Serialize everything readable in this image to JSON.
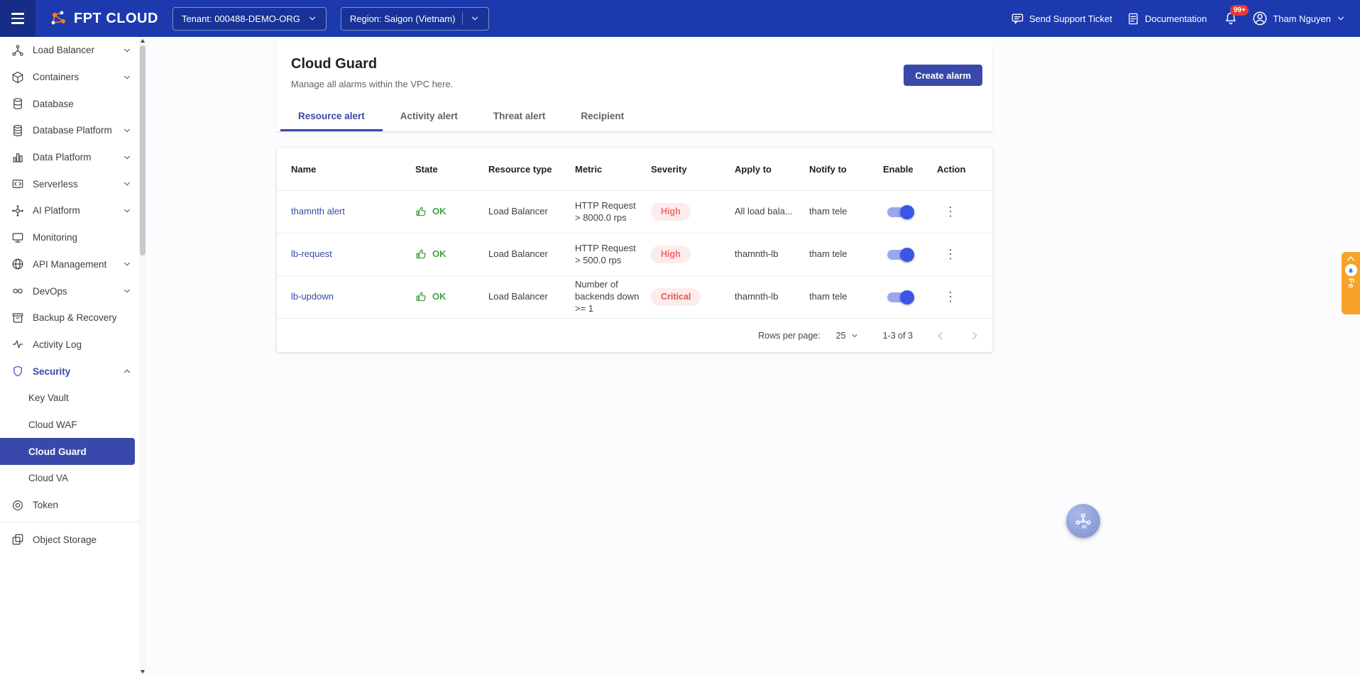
{
  "colors": {
    "topbar": "#1c3aae",
    "accent": "#3949ab",
    "accent_bright": "#3b55e6",
    "toggle_track": "#9aa7ef",
    "success": "#43a047",
    "severity_bg": "#fdecec",
    "severity_high": "#ef6b6b",
    "severity_critical": "#e25555",
    "badge_red": "#e53935",
    "feedback_orange": "#f7a32b"
  },
  "topbar": {
    "logo_text": "FPT CLOUD",
    "tenant": {
      "label": "Tenant: 000488-DEMO-ORG"
    },
    "region": {
      "label": "Region: Saigon (Vietnam)"
    },
    "support_label": "Send Support Ticket",
    "documentation_label": "Documentation",
    "notification_badge": "99+",
    "user_name": "Tham Nguyen"
  },
  "sidebar": {
    "items": [
      {
        "label": "Load Balancer",
        "icon": "load-balancer-icon"
      },
      {
        "label": "Containers",
        "icon": "containers-icon"
      },
      {
        "label": "Database",
        "icon": "database-icon"
      },
      {
        "label": "Database Platform",
        "icon": "database-platform-icon"
      },
      {
        "label": "Data Platform",
        "icon": "data-platform-icon"
      },
      {
        "label": "Serverless",
        "icon": "serverless-icon"
      },
      {
        "label": "AI Platform",
        "icon": "ai-platform-icon"
      },
      {
        "label": "Monitoring",
        "icon": "monitoring-icon"
      },
      {
        "label": "API Management",
        "icon": "api-management-icon"
      },
      {
        "label": "DevOps",
        "icon": "devops-icon"
      },
      {
        "label": "Backup & Recovery",
        "icon": "backup-recovery-icon"
      },
      {
        "label": "Activity Log",
        "icon": "activity-log-icon"
      },
      {
        "label": "Security",
        "icon": "security-icon"
      }
    ],
    "security_children": [
      "Key Vault",
      "Cloud WAF",
      "Cloud Guard",
      "Cloud VA"
    ],
    "selected_item": "Cloud Guard",
    "items_after": [
      {
        "label": "Token",
        "icon": "token-icon"
      },
      {
        "label": "Object Storage",
        "icon": "object-storage-icon"
      }
    ]
  },
  "page": {
    "title": "Cloud Guard",
    "subtitle": "Manage all alarms within the VPC here.",
    "create_button": "Create alarm",
    "tabs": [
      "Resource alert",
      "Activity alert",
      "Threat alert",
      "Recipient"
    ],
    "active_tab": "Resource alert"
  },
  "table": {
    "columns": [
      "Name",
      "State",
      "Resource type",
      "Metric",
      "Severity",
      "Apply to",
      "Notify to",
      "Enable",
      "Action"
    ],
    "rows": [
      {
        "name": "thamnth alert",
        "state": "OK",
        "resource_type": "Load Balancer",
        "metric": "HTTP Request > 8000.0 rps",
        "severity": "High",
        "apply_to": "All load bala...",
        "notify_to": "tham tele",
        "enabled": true
      },
      {
        "name": "lb-request",
        "state": "OK",
        "resource_type": "Load Balancer",
        "metric": "HTTP Request > 500.0 rps",
        "severity": "High",
        "apply_to": "thamnth-lb",
        "notify_to": "tham tele",
        "enabled": true
      },
      {
        "name": "lb-updown",
        "state": "OK",
        "resource_type": "Load Balancer",
        "metric": "Number of backends down >= 1",
        "severity": "Critical",
        "apply_to": "thamnth-lb",
        "notify_to": "tham tele",
        "enabled": true
      }
    ],
    "pagination": {
      "rows_per_page_label": "Rows per page:",
      "rows_per_page": "25",
      "range": "1-3 of 3"
    }
  },
  "feedback_tab": {
    "label": "Fe"
  }
}
